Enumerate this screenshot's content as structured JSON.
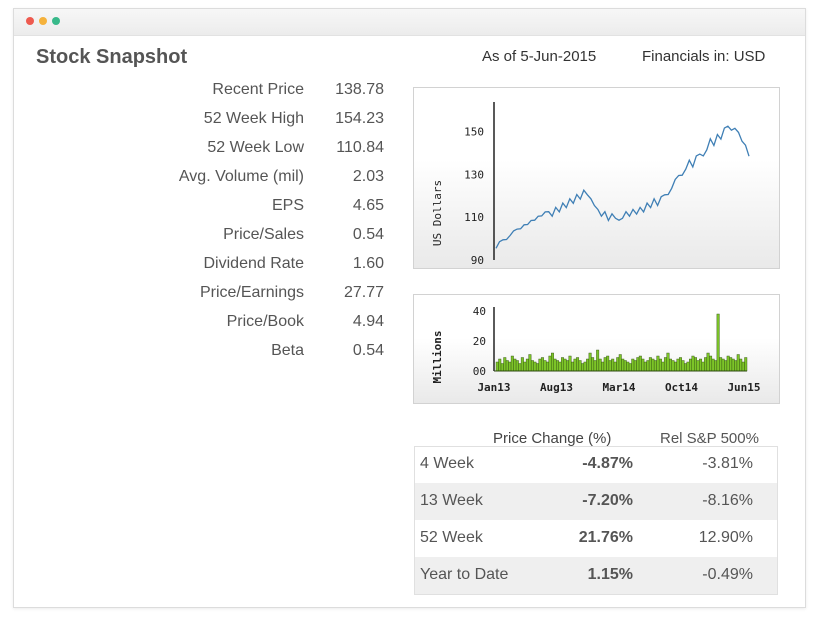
{
  "window_controls": [
    "close",
    "minimize",
    "zoom"
  ],
  "header": {
    "title": "Stock Snapshot",
    "as_of": "As of 5-Jun-2015",
    "financials": "Financials in: USD"
  },
  "stats": [
    {
      "label": "Recent Price",
      "value": "138.78"
    },
    {
      "label": "52 Week High",
      "value": "154.23"
    },
    {
      "label": "52 Week Low",
      "value": "110.84"
    },
    {
      "label": "Avg. Volume (mil)",
      "value": "2.03"
    },
    {
      "label": "EPS",
      "value": "4.65"
    },
    {
      "label": "Price/Sales",
      "value": "0.54"
    },
    {
      "label": "Dividend Rate",
      "value": "1.60"
    },
    {
      "label": "Price/Earnings",
      "value": "27.77"
    },
    {
      "label": "Price/Book",
      "value": "4.94"
    },
    {
      "label": "Beta",
      "value": "0.54"
    }
  ],
  "colors": {
    "price_line": "#3f7fb5",
    "volume_bars": "#7cc428",
    "volume_dark": "#2e4a10",
    "row_alt": "#efefef"
  },
  "chart_data": [
    {
      "type": "line",
      "ylabel": "US Dollars",
      "ylim": [
        90,
        160
      ],
      "yticks": [
        "150",
        "130",
        "110",
        "90"
      ],
      "x_start": "Jan13",
      "x_end": "Jun15",
      "series": [
        {
          "values": [
            96,
            98,
            100,
            99,
            102,
            103,
            105,
            104,
            107,
            106,
            109,
            108,
            111,
            110,
            113,
            112,
            111,
            114,
            113,
            116,
            115,
            118,
            117,
            120,
            119,
            122,
            121,
            118,
            116,
            113,
            111,
            112,
            109,
            111,
            110,
            108,
            110,
            112,
            111,
            113,
            112,
            114,
            113,
            116,
            115,
            118,
            116,
            119,
            121,
            120,
            124,
            127,
            130,
            129,
            133,
            136,
            134,
            138,
            140,
            138,
            142,
            146,
            144,
            148,
            147,
            151,
            153,
            150,
            152,
            149,
            146,
            143,
            139
          ]
        }
      ]
    },
    {
      "type": "bar",
      "ylabel": "Millions",
      "ylim": [
        0,
        40
      ],
      "yticks": [
        "40",
        "20",
        "00"
      ],
      "categories": [
        "Jan13",
        "Aug13",
        "Mar14",
        "Oct14",
        "Jun15"
      ],
      "series": [
        {
          "values": [
            6,
            8,
            5,
            9,
            7,
            6,
            10,
            8,
            7,
            5,
            9,
            6,
            8,
            11,
            7,
            6,
            5,
            8,
            9,
            7,
            6,
            10,
            12,
            8,
            7,
            6,
            9,
            8,
            7,
            10,
            6,
            8,
            9,
            7,
            5,
            6,
            8,
            12,
            9,
            7,
            14,
            8,
            6,
            9,
            10,
            7,
            8,
            6,
            9,
            11,
            8,
            7,
            6,
            5,
            8,
            7,
            9,
            10,
            8,
            6,
            7,
            9,
            8,
            7,
            10,
            8,
            6,
            9,
            12,
            8,
            7,
            6,
            8,
            9,
            7,
            5,
            6,
            8,
            10,
            9,
            7,
            8,
            6,
            9,
            12,
            10,
            8,
            7,
            38,
            9,
            8,
            7,
            10,
            9,
            8,
            7,
            11,
            8,
            6,
            9
          ]
        }
      ]
    }
  ],
  "price_change": {
    "header_change": "Price Change (%)",
    "header_rel": "Rel S&P 500%",
    "rows": [
      {
        "period": "4 Week",
        "change": "-4.87%",
        "rel": "-3.81%"
      },
      {
        "period": "13 Week",
        "change": "-7.20%",
        "rel": "-8.16%"
      },
      {
        "period": "52 Week",
        "change": "21.76%",
        "rel": "12.90%"
      },
      {
        "period": "Year to Date",
        "change": "1.15%",
        "rel": "-0.49%"
      }
    ]
  }
}
